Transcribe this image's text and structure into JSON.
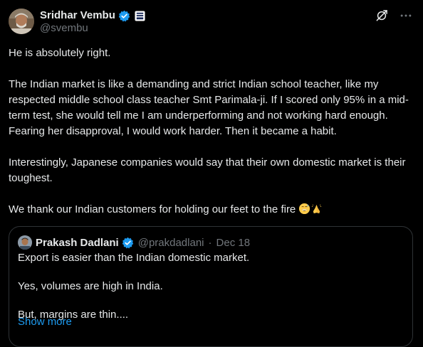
{
  "author": {
    "display_name": "Sridhar Vembu",
    "handle": "@svembu"
  },
  "tweet": {
    "paragraphs": [
      "He is absolutely right.",
      "The Indian market is like a demanding and strict Indian school teacher, like my respected middle school class teacher Smt Parimala-ji. If I scored only 95% in a mid-term test, she would tell me I am underperforming and not working hard enough. Fearing her disapproval, I would work harder. Then it became a habit.",
      "Interestingly, Japanese companies would say that their own domestic market is their toughest.",
      "We thank our Indian customers for holding our feet to the fire"
    ],
    "emojis": [
      "grinning-sweat-emoji",
      "folded-hands-emoji"
    ]
  },
  "quoted": {
    "display_name": "Prakash Dadlani",
    "handle": "@prakdadlani",
    "separator": "·",
    "date": "Dec 18",
    "lines": [
      "Export is easier than the Indian domestic market.",
      "Yes, volumes are high in India.",
      "But, margins are thin...."
    ],
    "show_more": "Show more"
  },
  "icons": {
    "verified": "verified-badge-icon",
    "affiliate": "affiliate-badge-icon",
    "grok": "grok-icon",
    "more": "more-icon"
  },
  "colors": {
    "background": "#000000",
    "text": "#e7e9ea",
    "muted": "#71767b",
    "accent": "#1d9bf0",
    "border": "#2f3336"
  }
}
